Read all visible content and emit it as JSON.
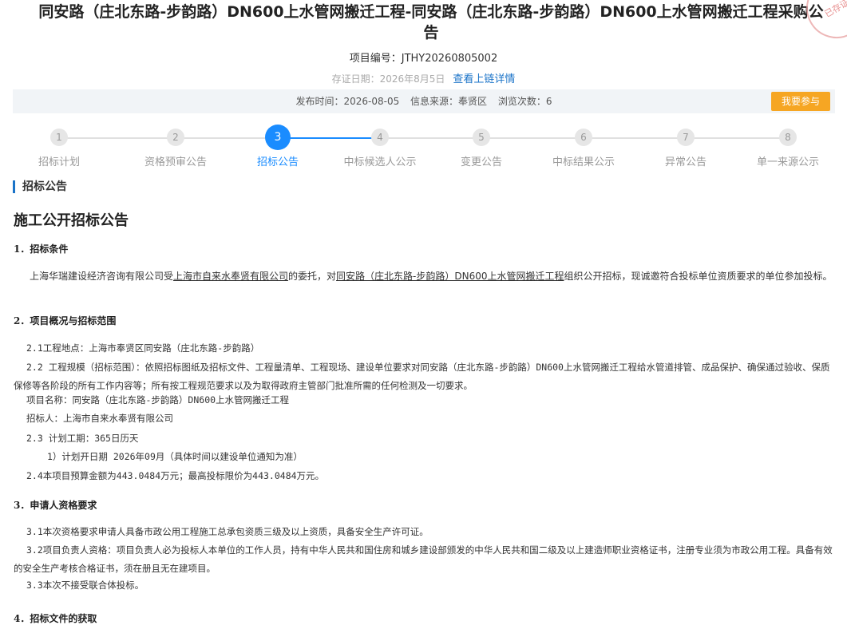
{
  "title": "同安路（庄北东路-步韵路）DN600上水管网搬迁工程-同安路（庄北东路-步韵路）DN600上水管网搬迁工程采购公告",
  "project_no": "项目编号：JTHY20260805002",
  "cert_date": "存证日期：2026年8月5日",
  "chain_link": "查看上链详情",
  "stamp_text": "已存证",
  "info": {
    "publish": "发布时间：2026-08-05",
    "source": "信息来源：奉贤区",
    "views": "浏览次数：6",
    "join_btn": "我要参与"
  },
  "steps": [
    {
      "num": "1",
      "label": "招标计划"
    },
    {
      "num": "2",
      "label": "资格预审公告"
    },
    {
      "num": "3",
      "label": "招标公告"
    },
    {
      "num": "4",
      "label": "中标候选人公示"
    },
    {
      "num": "5",
      "label": "变更公告"
    },
    {
      "num": "6",
      "label": "中标结果公示"
    },
    {
      "num": "7",
      "label": "异常公告"
    },
    {
      "num": "8",
      "label": "单一来源公示"
    }
  ],
  "active_step": 3,
  "section_heading": "招标公告",
  "doc_title": "施工公开招标公告",
  "s1": {
    "heading": "1．招标条件",
    "p_a": "上海华瑞建设经济咨询有限公司受",
    "p_b": "上海市自来水奉贤有限公司",
    "p_c": "的委托，对",
    "p_d": "同安路（庄北东路-步韵路）DN600上水管网搬迁工程",
    "p_e": "组织公开招标，现诚邀符合投标单位资质要求的单位参加投标。"
  },
  "s2": {
    "heading": "2．项目概况与招标范围",
    "l1": "2.1工程地点：上海市奉贤区同安路（庄北东路-步韵路）",
    "l2": "2.2 工程规模（招标范围）：依照招标图纸及招标文件、工程量清单、工程现场、建设单位要求对同安路（庄北东路-步韵路）DN600上水管网搬迁工程给水管道排管、成品保护、确保通过验收、保质保修等各阶段的所有工作内容等；所有按工程规范要求以及为取得政府主管部门批准所需的任何检测及一切要求。",
    "l3": "项目名称：同安路（庄北东路-步韵路）DN600上水管网搬迁工程",
    "l4": "招标人：上海市自来水奉贤有限公司",
    "l5": "2.3 计划工期：365日历天",
    "l6": "1）计划开日期 2026年09月（具体时间以建设单位通知为准）",
    "l7": "2.4本项目预算金额为443.0484万元；最高投标限价为443.0484万元。"
  },
  "s3": {
    "heading": "3．申请人资格要求",
    "l1": "3.1本次资格要求申请人具备市政公用工程施工总承包资质三级及以上资质，具备安全生产许可证。",
    "l2": "3.2项目负责人资格：项目负责人必为投标人本单位的工作人员，持有中华人民共和国住房和城乡建设部颁发的中华人民共和国二级及以上建造师职业资格证书，注册专业须为市政公用工程。具备有效的安全生产考核合格证书，须在册且无在建项目。",
    "l3": "3.3本次不接受联合体投标。"
  },
  "s4": {
    "heading": "4．招标文件的获取"
  }
}
